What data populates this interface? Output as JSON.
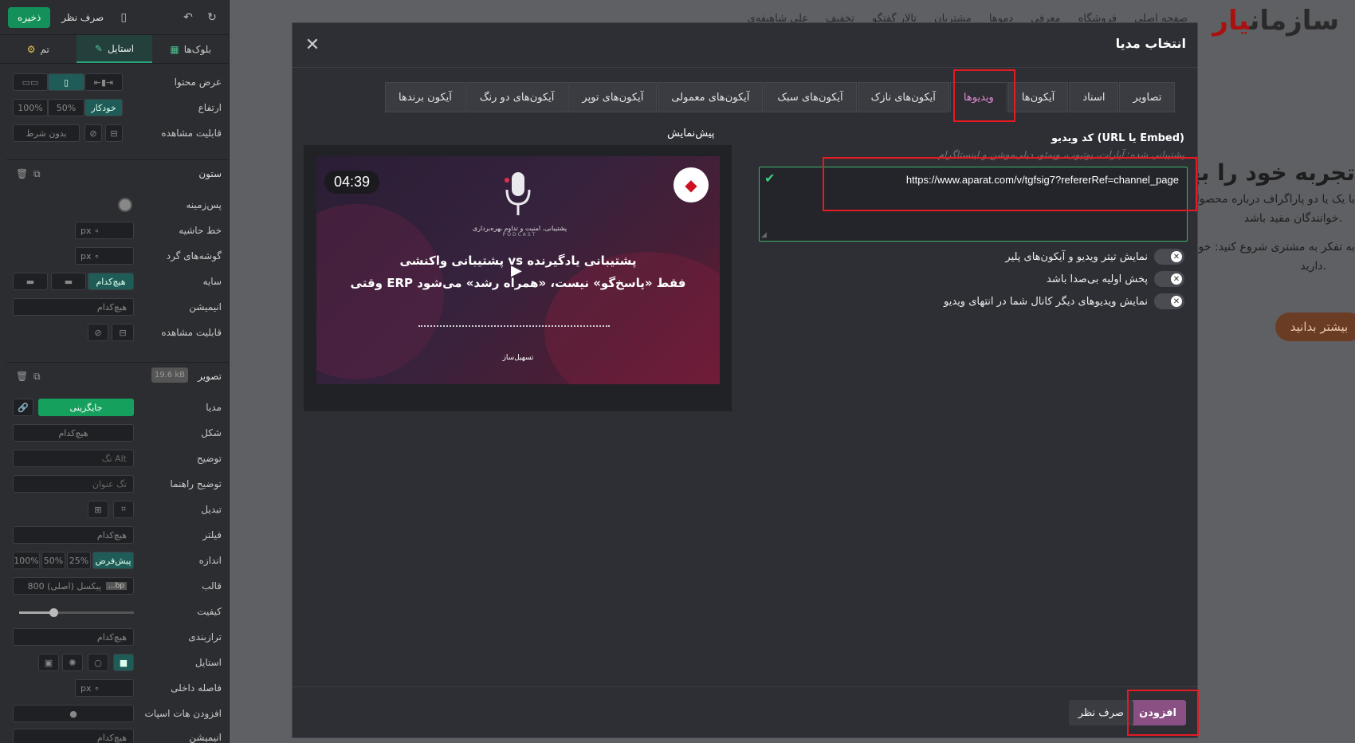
{
  "sidebar": {
    "save_label": "ذخیره",
    "discard_label": "صرف نظر",
    "tabs": {
      "theme": "تم",
      "style": "استایل",
      "blocks": "بلوک‌ها"
    },
    "rows_top": [
      {
        "label": "عرض محتوا"
      },
      {
        "label": "ارتفاع",
        "options": [
          "100%",
          "50%",
          "خودکار"
        ]
      },
      {
        "label": "قابلیت مشاهده",
        "select": "بدون شرط"
      }
    ],
    "column_section": {
      "title": "ستون",
      "rows": [
        {
          "label": "پس‌زمینه"
        },
        {
          "label": "خط حاشیه",
          "placeholder": "px ∘"
        },
        {
          "label": "گوشه‌های گرد",
          "placeholder": "px ∘"
        },
        {
          "label": "سایه",
          "value": "هیچ‌کدام"
        },
        {
          "label": "انیمیشن",
          "value": "هیچ‌کدام"
        },
        {
          "label": "قابلیت مشاهده"
        }
      ]
    },
    "image_section": {
      "title": "تصویر",
      "size_badge": "19.6 kB",
      "rows": [
        {
          "label": "مدیا",
          "button": "جایگزینی"
        },
        {
          "label": "شکل",
          "value": "هیچ‌کدام"
        },
        {
          "label": "توضیح",
          "placeholder": "تگ Alt"
        },
        {
          "label": "توضیح راهنما",
          "placeholder": "تگ عنوان"
        },
        {
          "label": "تبدیل"
        },
        {
          "label": "فیلتر",
          "value": "هیچ‌کدام"
        },
        {
          "label": "اندازه",
          "options": [
            "100%",
            "50%",
            "25%",
            "پیش‌فرض"
          ]
        },
        {
          "label": "قالب",
          "value": "800 پیکسل (اصلی)",
          "format": "...bp"
        },
        {
          "label": "کیفیت",
          "quality_level": 0.3
        },
        {
          "label": "ترازبندی",
          "value": "هیچ‌کدام"
        },
        {
          "label": "استایل"
        },
        {
          "label": "فاصله داخلی",
          "placeholder": "px ∘"
        },
        {
          "label": "افزودن هات اسپات"
        },
        {
          "label": "انیمیشن",
          "value": "هیچ‌کدام"
        }
      ]
    }
  },
  "background_page": {
    "logo_part1": "سازمان",
    "logo_part2": "یار",
    "nav_items": [
      "صفحه اصلی",
      "فروشگاه",
      "معرفی",
      "دموها",
      "مشتریان",
      "تالار گفتگو",
      "تخفیف",
      "علی شاهیفه‌ی"
    ],
    "heading": "تجربه خود را بهبو",
    "para1": "با یک یا دو پاراگراف درباره محصول ب",
    "para2": "خوانندگان مفید باشد.",
    "para3": "به تفکر به مشتری شروع کنید: خوا",
    "para4": "دارید.",
    "button": "بیشتر بدانید"
  },
  "modal": {
    "title": "انتخاب مدیا",
    "tabs": [
      "تصاویر",
      "اسناد",
      "آیکون‌ها",
      "ویدیوها",
      "آیکون‌های نازک",
      "آیکون‌های سبک",
      "آیکون‌های معمولی",
      "آیکون‌های توپر",
      "آیکون‌های دو رنگ",
      "آیکون برندها"
    ],
    "active_tab_index": 3,
    "field_label": "کد ویدیو (URL یا Embed)",
    "field_hint": "پشتیبانی شده: آپارات، یوتیوب، ویمئو، دیلی‌موشن و اینستاگرام",
    "url_value": "https://www.aparat.com/v/tgfsig7?refererRef=channel_page",
    "options": [
      "نمایش تیتر ویدیو و آیکون‌های پلیر",
      "پخش اولیه بی‌صدا باشد",
      "نمایش ویدیوهای دیگر کانال شما در انتهای ویدیو"
    ],
    "preview_label": "پیش‌نمایش",
    "video": {
      "duration": "04:39",
      "subtitle": "پشتیبانی، امنیت و تداوم بهره‌برداری",
      "podcast": "PODCAST",
      "line1": "پشتیبانی واکنشی vs پشتیبانی یادگیرنده",
      "line2": "وقتی ERP فقط «پاسخ‌گو» نیست، «همراه رشد» می‌شود",
      "brand": "تسهیل‌ساز"
    },
    "add_label": "افزودن",
    "cancel_label": "صرف نظر"
  }
}
